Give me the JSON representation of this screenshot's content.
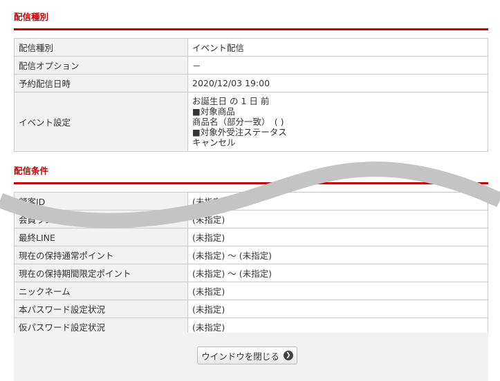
{
  "section1": {
    "title": "配信種別",
    "rows": [
      {
        "label": "配信種別",
        "value": "イベント配信"
      },
      {
        "label": "配信オプション",
        "value": "－"
      },
      {
        "label": "予約配信日時",
        "value": "2020/12/03 19:00"
      }
    ],
    "event": {
      "label": "イベント設定",
      "lines": [
        "お誕生日 の 1 日 前",
        "■対象商品",
        "商品名（部分一致）　( )",
        "■対象外受注ステータス",
        "キャンセル"
      ]
    }
  },
  "section2": {
    "title": "配信条件",
    "rows": [
      {
        "label": "顧客ID",
        "value": "(未指定)"
      },
      {
        "label": "会員ランク(複数指定)",
        "value": "(未指定)"
      },
      {
        "label": "最終LINE",
        "value": "(未指定)"
      },
      {
        "label": "現在の保持通常ポイント",
        "value": "(未指定) ～ (未指定)"
      },
      {
        "label": "現在の保持期間限定ポイント",
        "value": "(未指定) ～ (未指定)"
      },
      {
        "label": "ニックネーム",
        "value": "(未指定)"
      },
      {
        "label": "本パスワード設定状況",
        "value": "(未指定)"
      },
      {
        "label": "仮パスワード設定状況",
        "value": "(未指定)"
      }
    ]
  },
  "footer": {
    "close_label": "ウインドウを閉じる"
  }
}
